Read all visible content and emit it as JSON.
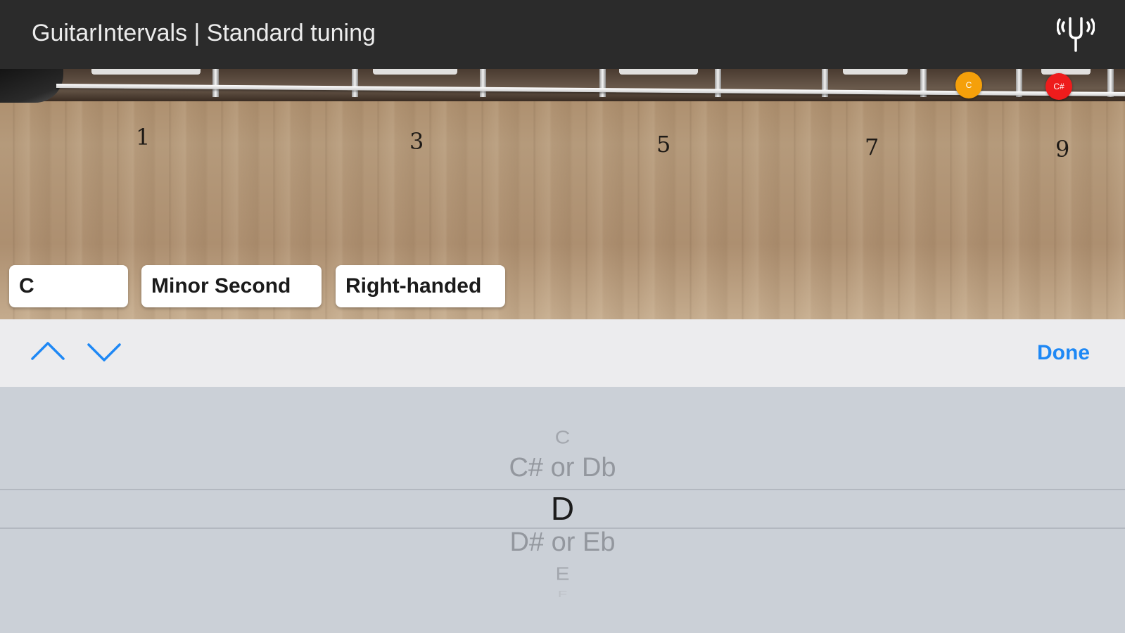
{
  "header": {
    "title": "GuitarIntervals | Standard tuning",
    "tuner_icon": "tuning-fork-icon"
  },
  "fretboard": {
    "fret_numbers": [
      "1",
      "3",
      "5",
      "7",
      "9"
    ],
    "markers": [
      {
        "label": "C",
        "color": "#f5a00a"
      },
      {
        "label": "C#",
        "color": "#ee1c1c"
      }
    ]
  },
  "controls": {
    "root_note": "C",
    "interval": "Minor Second",
    "handedness": "Right-handed"
  },
  "toolbar": {
    "previous_icon": "chevron-up-icon",
    "next_icon": "chevron-down-icon",
    "done_label": "Done",
    "accent_color": "#1e88f5"
  },
  "picker": {
    "options": [
      "C",
      "C# or Db",
      "D",
      "D# or Eb",
      "E",
      "F"
    ],
    "selected": "D"
  }
}
